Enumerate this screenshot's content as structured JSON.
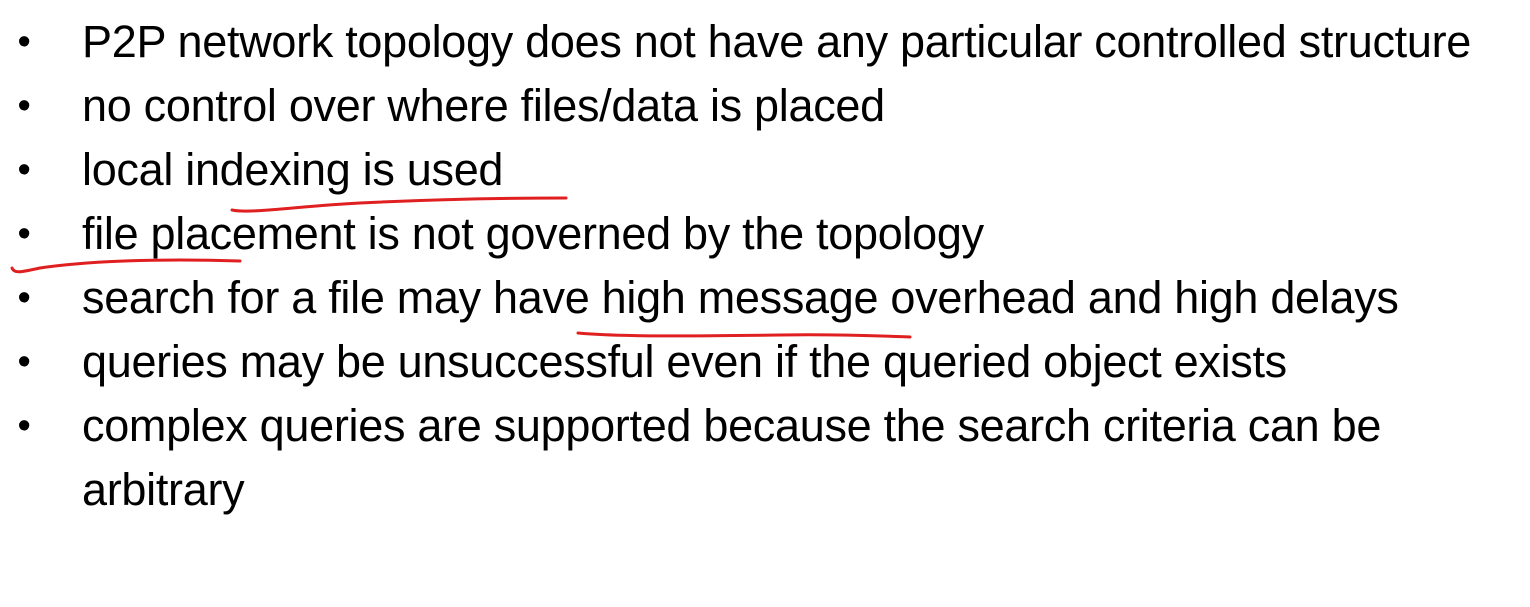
{
  "bullets": [
    {
      "text": "P2P network topology does not have any particular controlled structure"
    },
    {
      "text": "no control over where files/data is placed"
    },
    {
      "text": "local indexing is used"
    },
    {
      "text": "file placement is not governed by the topology"
    },
    {
      "text": "search for a file may have high message overhead and high delays"
    },
    {
      "text": "queries may be unsuccessful even if the queried object exists"
    },
    {
      "text": "complex queries are supported because the search criteria can be arbitrary"
    }
  ],
  "bullet_symbol": "•",
  "colors": {
    "text": "#000000",
    "background": "#ffffff",
    "annotation": "#e02020"
  }
}
